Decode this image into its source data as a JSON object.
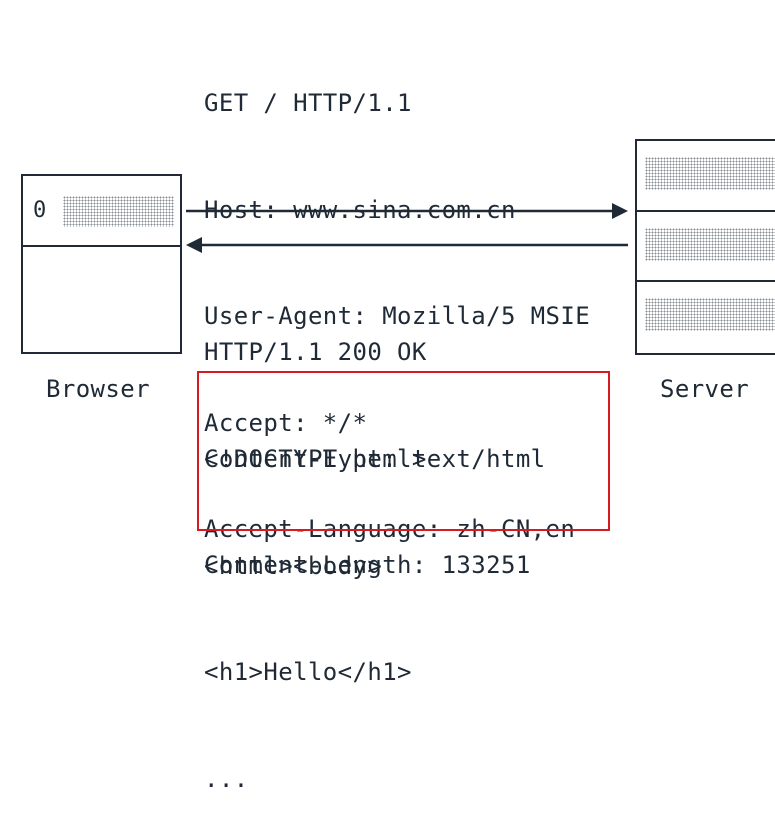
{
  "request": {
    "lines": [
      "GET / HTTP/1.1",
      "Host: www.sina.com.cn",
      "User-Agent: Mozilla/5 MSIE",
      "Accept: */*",
      "Accept-Language: zh-CN,en"
    ]
  },
  "response": {
    "lines": [
      "HTTP/1.1 200 OK",
      "Content-Type: text/html",
      "Content-Length: 133251"
    ]
  },
  "body": {
    "lines": [
      "<!DOCTYPE html>",
      "<html><body>",
      "<h1>Hello</h1>",
      "..."
    ]
  },
  "browser": {
    "label": "Browser",
    "tab_number": "0"
  },
  "server": {
    "label": "Server"
  },
  "colors": {
    "ink": "#1f2a36",
    "highlight_border": "#d71920",
    "hatch": "#8a8f96"
  }
}
